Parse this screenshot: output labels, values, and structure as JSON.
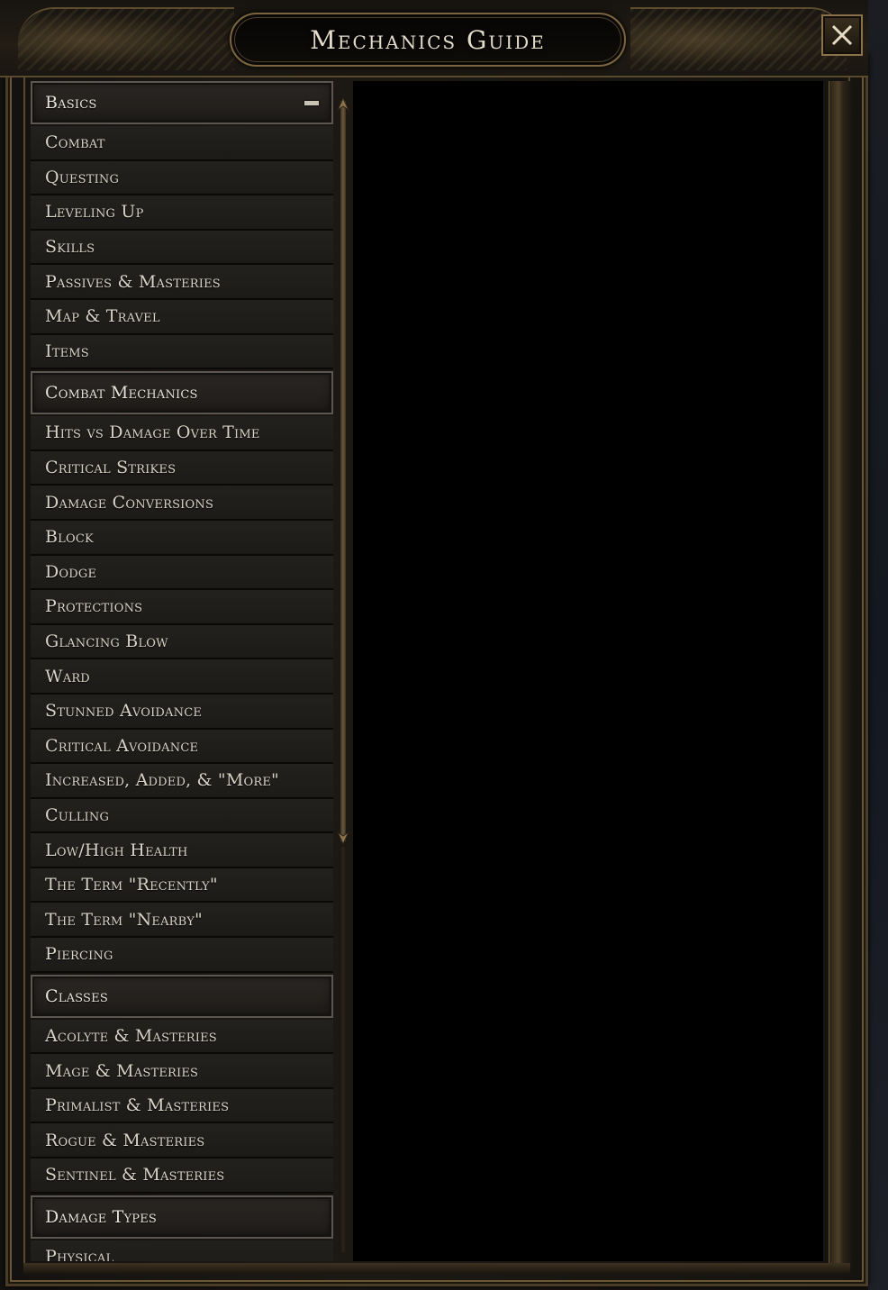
{
  "window": {
    "title": "Mechanics Guide",
    "close_icon": "close-icon"
  },
  "list": {
    "items": [
      {
        "label": "Basics",
        "section": true,
        "expanded": true
      },
      {
        "label": "Combat",
        "section": false
      },
      {
        "label": "Questing",
        "section": false
      },
      {
        "label": "Leveling Up",
        "section": false
      },
      {
        "label": "Skills",
        "section": false
      },
      {
        "label": "Passives & Masteries",
        "section": false
      },
      {
        "label": "Map & Travel",
        "section": false
      },
      {
        "label": "Items",
        "section": false
      },
      {
        "label": "Combat Mechanics",
        "section": true
      },
      {
        "label": "Hits vs Damage Over Time",
        "section": false
      },
      {
        "label": "Critical Strikes",
        "section": false
      },
      {
        "label": "Damage Conversions",
        "section": false
      },
      {
        "label": "Block",
        "section": false
      },
      {
        "label": "Dodge",
        "section": false
      },
      {
        "label": "Protections",
        "section": false
      },
      {
        "label": "Glancing Blow",
        "section": false
      },
      {
        "label": "Ward",
        "section": false
      },
      {
        "label": "Stunned Avoidance",
        "section": false
      },
      {
        "label": "Critical Avoidance",
        "section": false
      },
      {
        "label": "Increased, Added, & \"More\"",
        "section": false
      },
      {
        "label": "Culling",
        "section": false
      },
      {
        "label": "Low/High Health",
        "section": false
      },
      {
        "label": "The Term \"Recently\"",
        "section": false
      },
      {
        "label": "The Term \"Nearby\"",
        "section": false
      },
      {
        "label": "Piercing",
        "section": false
      },
      {
        "label": "Classes",
        "section": true
      },
      {
        "label": "Acolyte & Masteries",
        "section": false
      },
      {
        "label": "Mage & Masteries",
        "section": false
      },
      {
        "label": "Primalist & Masteries",
        "section": false
      },
      {
        "label": "Rogue & Masteries",
        "section": false
      },
      {
        "label": "Sentinel & Masteries",
        "section": false
      },
      {
        "label": "Damage Types",
        "section": true
      },
      {
        "label": "Physical",
        "section": false
      }
    ]
  },
  "icons": {
    "collapse": "minus-icon",
    "scroll_up": "scroll-up-arrow-icon",
    "scroll_down": "scroll-down-arrow-icon"
  },
  "colors": {
    "frame_gold": "#6b5734",
    "text": "#d9d4c8",
    "content_bg": "#000000"
  }
}
